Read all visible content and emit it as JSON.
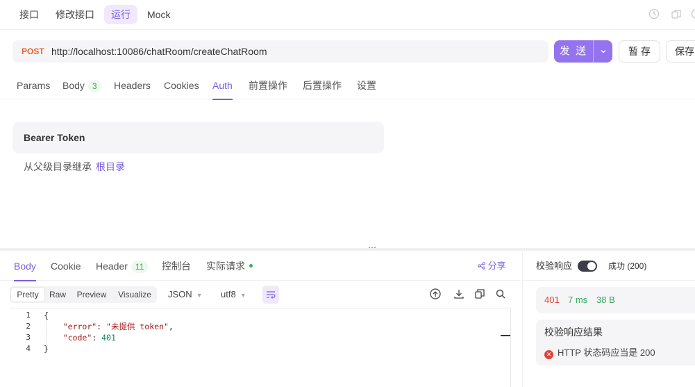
{
  "top_tabs": [
    {
      "label": "接口"
    },
    {
      "label": "修改接口"
    },
    {
      "label": "运行",
      "active": true
    },
    {
      "label": "Mock"
    }
  ],
  "request": {
    "method": "POST",
    "url": "http://localhost:10086/chatRoom/createChatRoom",
    "send_label": "发 送",
    "save_label": "暂 存",
    "save2_label": "保存"
  },
  "req_tabs": [
    {
      "label": "Params"
    },
    {
      "label": "Body",
      "badge": "3"
    },
    {
      "label": "Headers"
    },
    {
      "label": "Cookies"
    },
    {
      "label": "Auth",
      "active": true
    },
    {
      "label": "前置操作"
    },
    {
      "label": "后置操作"
    },
    {
      "label": "设置"
    }
  ],
  "auth": {
    "type_label": "Bearer Token",
    "inherit_text": "从父级目录继承",
    "inherit_link": "根目录"
  },
  "resp_tabs": [
    {
      "label": "Body",
      "active": true
    },
    {
      "label": "Cookie"
    },
    {
      "label": "Header",
      "badge": "11"
    },
    {
      "label": "控制台"
    },
    {
      "label": "实际请求"
    }
  ],
  "share_label": "分享",
  "view_modes": [
    "Pretty",
    "Raw",
    "Preview",
    "Visualize"
  ],
  "format_select": "JSON",
  "encoding_select": "utf8",
  "code": {
    "line_numbers": [
      "1",
      "2",
      "3",
      "4"
    ],
    "open_brace": "{",
    "error_key": "\"error\"",
    "error_value": "\"未提供 token\"",
    "code_key": "\"code\"",
    "code_value": "401",
    "close_brace": "}"
  },
  "validation": {
    "title": "校验响应",
    "toggle_on": true,
    "result": "成功 (200)",
    "status_code": "401",
    "time": "7 ms",
    "size": "38 B",
    "result_title": "校验响应结果",
    "result_item": "HTTP 状态码应当是 200"
  },
  "colors": {
    "accent": "#7b5fe0",
    "send_button": "#9373ee",
    "method": "#e8622c",
    "error": "#e0433a",
    "success": "#3aa55f"
  }
}
